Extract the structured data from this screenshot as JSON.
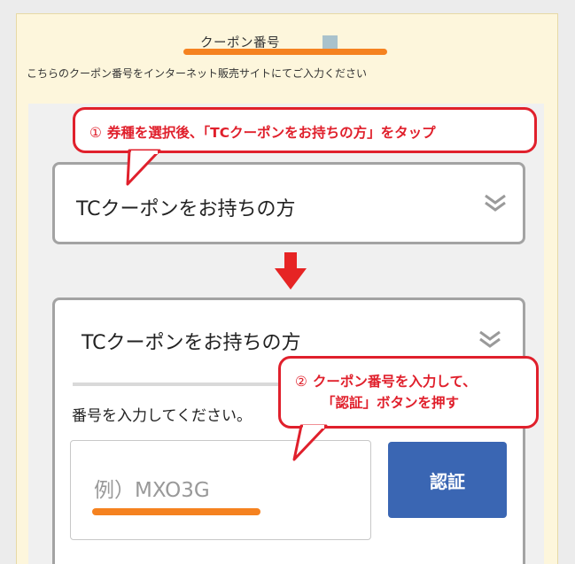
{
  "header": {
    "title": "クーポン番号",
    "description": "こちらのクーポン番号をインターネット販売サイトにてご入力ください"
  },
  "annotations": {
    "step1_number": "①",
    "step1_text": "券種を選択後、「TCクーポンをお持ちの方」をタップ",
    "step2_number": "②",
    "step2_line1": "クーポン番号を入力して、",
    "step2_line2": "「認証」ボタンを押す"
  },
  "coupon_type_select": {
    "selected": "TCクーポンをお持ちの方"
  },
  "coupon_form": {
    "selected": "TCクーポンをお持ちの方",
    "prompt": "番号を入力してください。",
    "input_placeholder": "例）MXO3G",
    "input_value": "",
    "submit_label": "認証"
  },
  "colors": {
    "accent_orange": "#f58220",
    "annotation_red": "#e0202c",
    "button_blue": "#3a66b3",
    "card_background": "#fdf6dc"
  }
}
